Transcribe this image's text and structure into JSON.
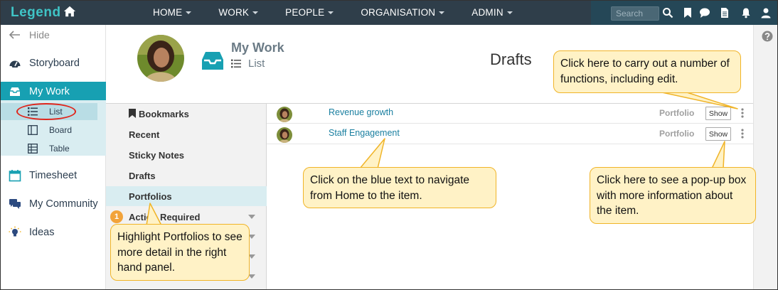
{
  "app": {
    "logo": "Legend",
    "nav": [
      "HOME",
      "WORK",
      "PEOPLE",
      "ORGANISATION",
      "ADMIN"
    ],
    "search_placeholder": "Search"
  },
  "sidebar": {
    "hide_label": "Hide",
    "items": [
      {
        "label": "Storyboard",
        "icon": "dashboard-icon"
      },
      {
        "label": "My Work",
        "icon": "inbox-icon",
        "active": true
      },
      {
        "label": "Timesheet",
        "icon": "calendar-icon"
      },
      {
        "label": "My Community",
        "icon": "chat-icon"
      },
      {
        "label": "Ideas",
        "icon": "lightbulb-icon"
      }
    ],
    "sub_items": [
      {
        "label": "List",
        "icon": "list-icon",
        "active": true
      },
      {
        "label": "Board",
        "icon": "board-icon"
      },
      {
        "label": "Table",
        "icon": "table-icon"
      }
    ]
  },
  "header": {
    "title": "My Work",
    "view": "List",
    "section": "Drafts"
  },
  "midlist": {
    "items": [
      {
        "label": "Bookmarks"
      },
      {
        "label": "Recent"
      },
      {
        "label": "Sticky Notes"
      },
      {
        "label": "Drafts"
      },
      {
        "label": "Portfolios",
        "highlight": true
      },
      {
        "label": "Action Required",
        "badge": "1"
      }
    ]
  },
  "rows": [
    {
      "title": "Revenue growth",
      "type": "Portfolio",
      "button": "Show"
    },
    {
      "title": "Staff Engagement",
      "type": "Portfolio",
      "button": "Show"
    }
  ],
  "callouts": {
    "functions": "Click here to carry out a number of functions, including edit.",
    "navigate": "Click on the blue text to navigate from Home to the item.",
    "popup": "Click here to see a pop-up box with more information about the item.",
    "portfolios": "Highlight Portfolios to see more detail in the right hand panel."
  },
  "colors": {
    "navbar": "#2f3e4a",
    "accent": "#17a0b2",
    "link": "#1a7fa0",
    "callout_fill": "#fff2c6",
    "callout_border": "#f0b428",
    "highlight_ellipse": "#e0251b"
  }
}
